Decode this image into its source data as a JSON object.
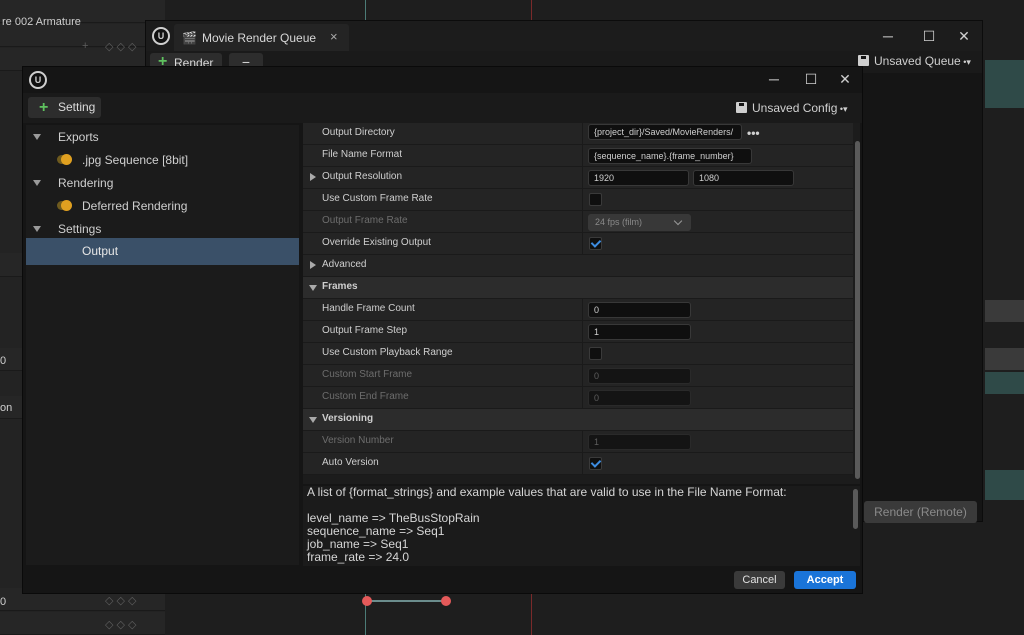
{
  "background": {
    "track_label": "re 002 Armature",
    "side_values": [
      "0",
      "on",
      "0"
    ]
  },
  "mrq": {
    "title": "Movie Render Queue",
    "tab_close": "×",
    "render_label": "Render",
    "minus_label": "−",
    "unsaved_queue": "Unsaved Queue",
    "render_remote": "Render (Remote)"
  },
  "dialog": {
    "setting_label": "Setting",
    "unsaved_config": "Unsaved Config",
    "window_controls": {
      "minimize": "─",
      "maximize": "☐",
      "close": "✕"
    },
    "tree": {
      "exports_label": "Exports",
      "jpg_label": ".jpg Sequence [8bit]",
      "rendering_label": "Rendering",
      "deferred_label": "Deferred Rendering",
      "settings_label": "Settings",
      "output_label": "Output"
    },
    "props": {
      "output_directory": {
        "label": "Output Directory",
        "value": "{project_dir}/Saved/MovieRenders/",
        "browse": "•••"
      },
      "file_name_format": {
        "label": "File Name Format",
        "value": "{sequence_name}.{frame_number}"
      },
      "output_resolution": {
        "label": "Output Resolution",
        "x": "1920",
        "y": "1080"
      },
      "use_custom_frame_rate": {
        "label": "Use Custom Frame Rate",
        "checked": false
      },
      "output_frame_rate": {
        "label": "Output Frame Rate",
        "value": "24 fps (film)"
      },
      "override_existing_output": {
        "label": "Override Existing Output",
        "checked": true
      },
      "advanced": {
        "label": "Advanced"
      },
      "frames_category": "Frames",
      "handle_frame_count": {
        "label": "Handle Frame Count",
        "value": "0"
      },
      "output_frame_step": {
        "label": "Output Frame Step",
        "value": "1"
      },
      "use_custom_playback_range": {
        "label": "Use Custom Playback Range",
        "checked": false
      },
      "custom_start_frame": {
        "label": "Custom Start Frame",
        "value": "0"
      },
      "custom_end_frame": {
        "label": "Custom End Frame",
        "value": "0"
      },
      "versioning_category": "Versioning",
      "version_number": {
        "label": "Version Number",
        "value": "1"
      },
      "auto_version": {
        "label": "Auto Version",
        "checked": true
      }
    },
    "description": {
      "intro": "A list of {format_strings} and example values that are valid to use in the File Name Format:",
      "examples": [
        "level_name => TheBusStopRain",
        "sequence_name => Seq1",
        "job_name => Seq1",
        "frame_rate => 24.0"
      ]
    },
    "cancel_label": "Cancel",
    "accept_label": "Accept"
  },
  "colors": {
    "accent_blue": "#1a74d8",
    "selection": "#3a5068",
    "checkbox": "#3d8ce0",
    "toggle_orange": "#e0a020",
    "add_green": "#5fc25f"
  }
}
